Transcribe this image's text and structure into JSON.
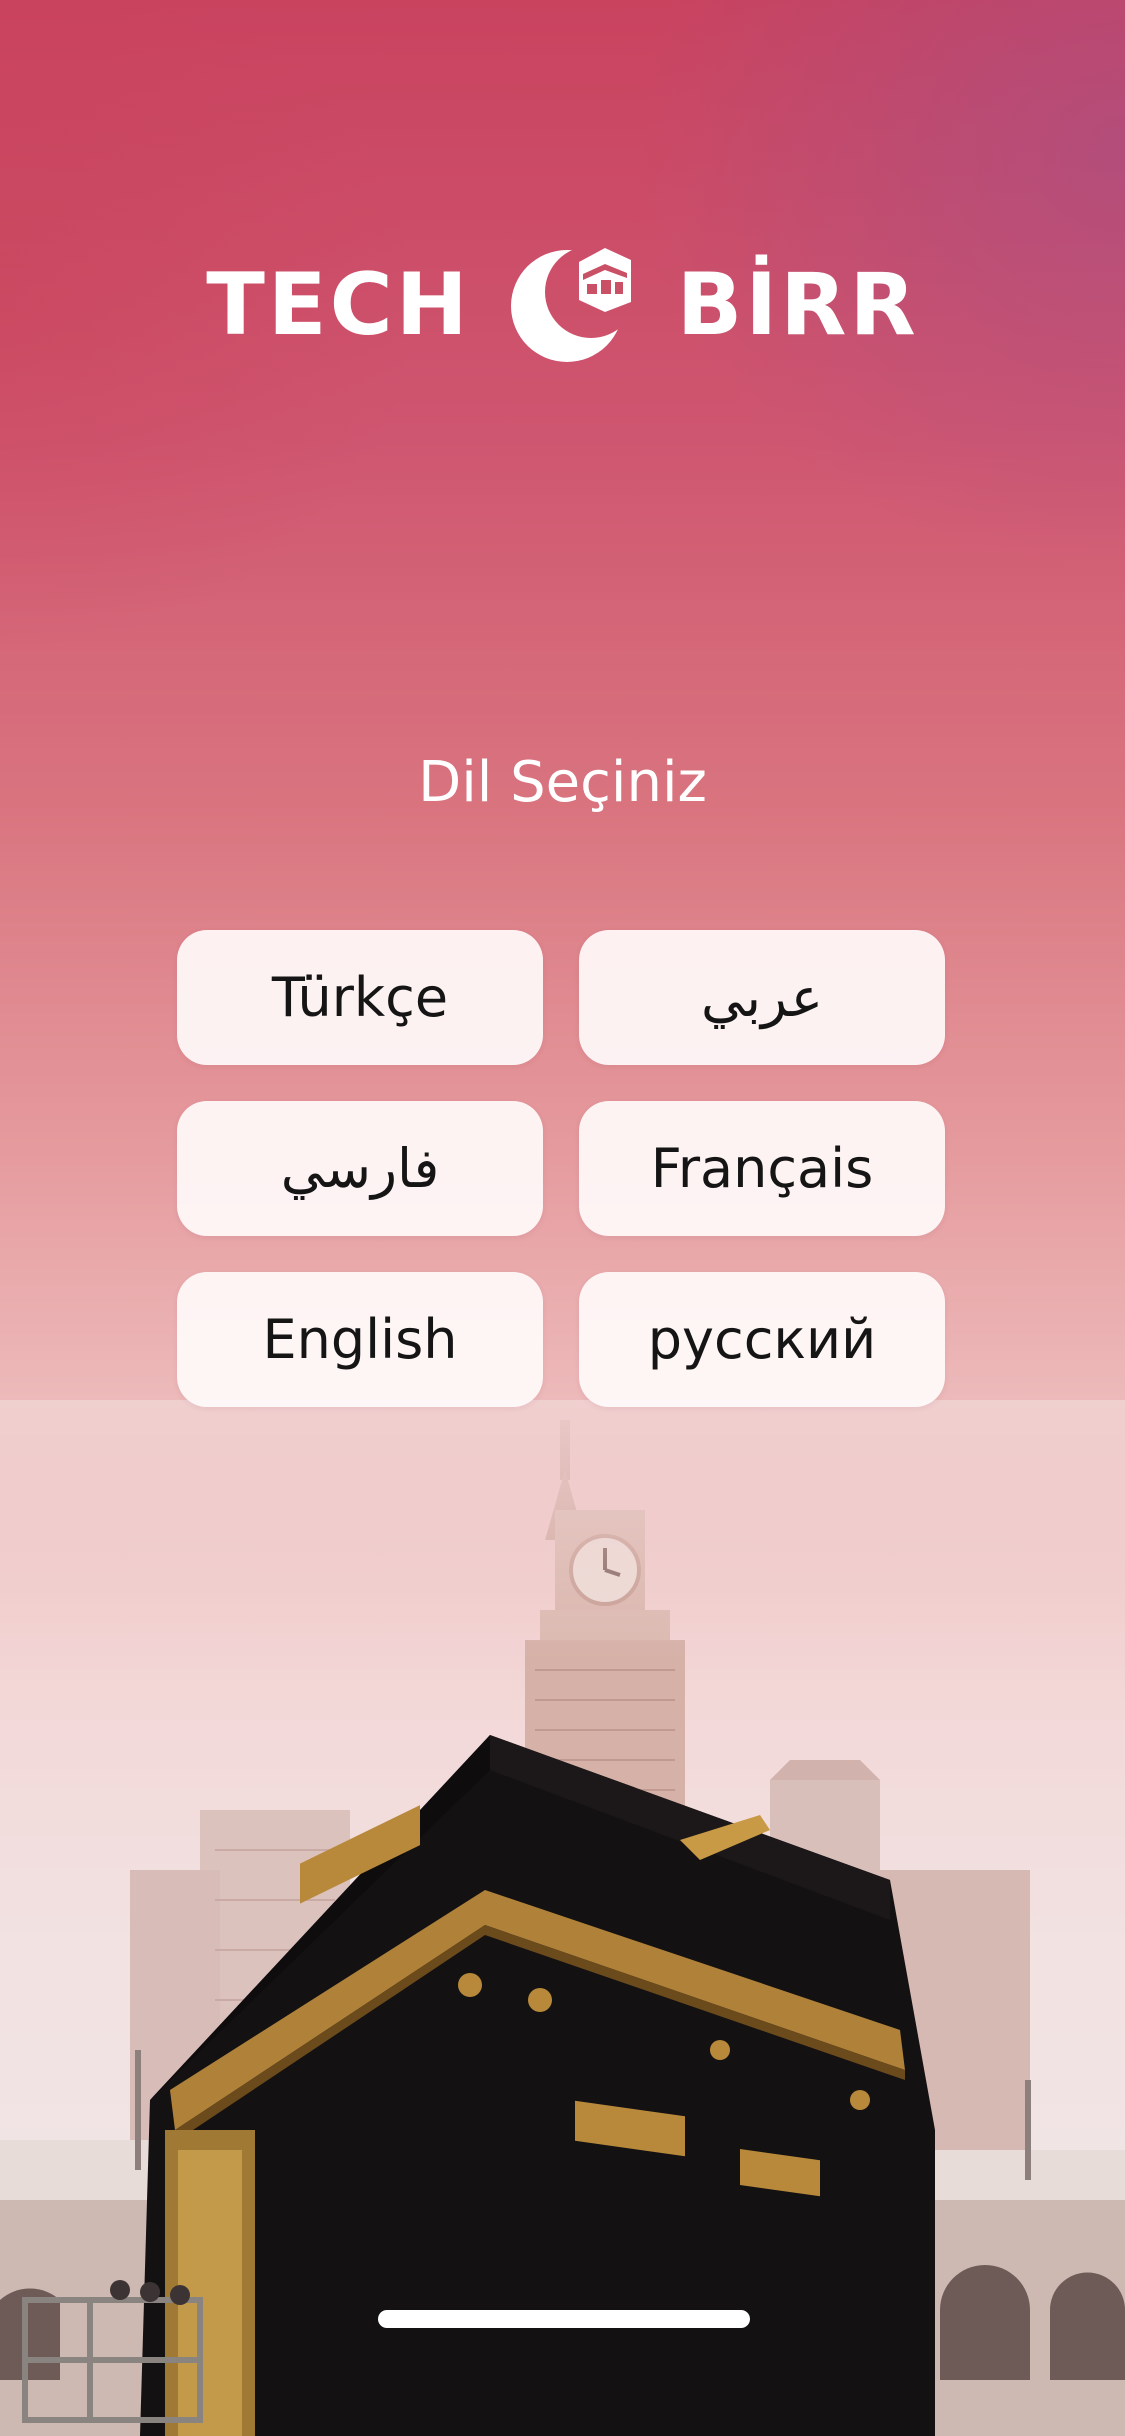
{
  "brand": {
    "left_word": "TECH",
    "right_word": "BİRR",
    "logo_icon": "crescent-kaaba-logo-icon"
  },
  "title": "Dil Seçiniz",
  "languages": [
    {
      "label": "Türkçe"
    },
    {
      "label": "عربي"
    },
    {
      "label": "فارسي"
    },
    {
      "label": "Français"
    },
    {
      "label": "English"
    },
    {
      "label": "русский"
    }
  ],
  "colors": {
    "top": "#c9435f",
    "mid": "#e59a9d",
    "bottom": "#efe6e6",
    "button_bg": "#fffafa",
    "button_text": "#151515",
    "kaaba": "#121012",
    "gold": "#b8893b"
  }
}
